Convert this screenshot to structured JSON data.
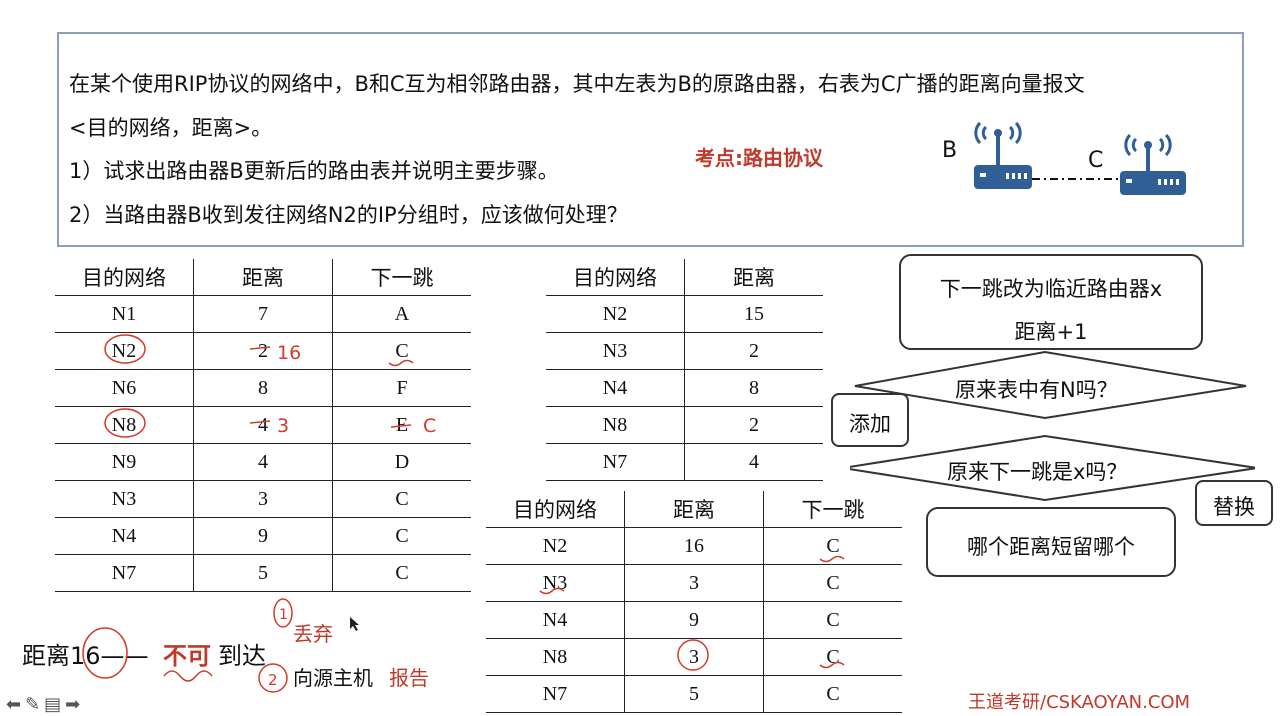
{
  "question": {
    "line1": "在某个使用RIP协议的网络中，B和C互为相邻路由器，其中左表为B的原路由器，右表为C广播的距离向量报文",
    "line2": "<目的网络，距离>。",
    "line3": "1）试求出路由器B更新后的路由表并说明主要步骤。",
    "line4": "2）当路由器B收到发往网络N2的IP分组时，应该做何处理？",
    "keypoint": "考点:路由协议"
  },
  "diagram": {
    "label_b": "B",
    "label_c": "C",
    "router_color": "#2f5f95"
  },
  "table_b": {
    "headers": [
      "目的网络",
      "距离",
      "下一跳"
    ],
    "rows": [
      [
        "N1",
        "7",
        "A"
      ],
      [
        "N2",
        "2",
        "C"
      ],
      [
        "N6",
        "8",
        "F"
      ],
      [
        "N8",
        "4",
        "E"
      ],
      [
        "N9",
        "4",
        "D"
      ],
      [
        "N3",
        "3",
        "C"
      ],
      [
        "N4",
        "9",
        "C"
      ],
      [
        "N7",
        "5",
        "C"
      ]
    ],
    "annotations": {
      "n2_distance": "16",
      "n8_distance": "3",
      "n8_next": "C"
    }
  },
  "table_c": {
    "headers": [
      "目的网络",
      "距离"
    ],
    "rows": [
      [
        "N2",
        "15"
      ],
      [
        "N3",
        "2"
      ],
      [
        "N4",
        "8"
      ],
      [
        "N8",
        "2"
      ],
      [
        "N7",
        "4"
      ]
    ]
  },
  "table_new": {
    "headers": [
      "目的网络",
      "距离",
      "下一跳"
    ],
    "rows": [
      [
        "N2",
        "16",
        "C"
      ],
      [
        "N3",
        "3",
        "C"
      ],
      [
        "N4",
        "9",
        "C"
      ],
      [
        "N8",
        "3",
        "C"
      ],
      [
        "N7",
        "5",
        "C"
      ]
    ]
  },
  "flowchart": {
    "step1_line1": "下一跳改为临近路由器x",
    "step1_line2": "距离+1",
    "q1": "原来表中有N吗？",
    "add": "添加",
    "q2": "原来下一跳是x吗？",
    "replace": "替换",
    "keep": "哪个距离短留哪个"
  },
  "notes": {
    "dist16": "距离16——",
    "unreachable": "不可",
    "arrive": "到达",
    "step1_num": "1",
    "discard": "丢弃",
    "step2_num": "2",
    "report_a": "向源主机",
    "report_b": "报告"
  },
  "watermark": "王道考研/CSKAOYAN.COM",
  "nav": "⬅✎▤➡",
  "colors": {
    "accent_red": "#c0392b",
    "box_border": "#8aa0bd"
  }
}
